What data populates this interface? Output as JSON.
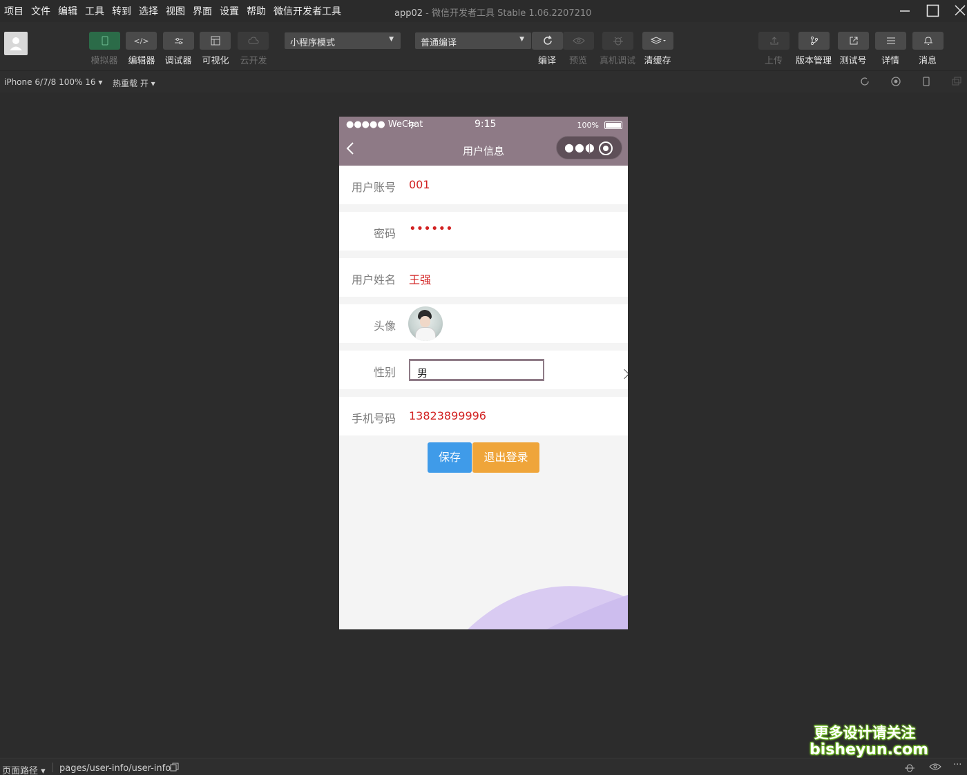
{
  "menu": [
    "项目",
    "文件",
    "编辑",
    "工具",
    "转到",
    "选择",
    "视图",
    "界面",
    "设置",
    "帮助",
    "微信开发者工具"
  ],
  "window": {
    "project": "app02",
    "separator": " - ",
    "app": "微信开发者工具 Stable 1.06.2207210"
  },
  "toolbar": {
    "left_buttons": [
      {
        "label": "模拟器",
        "icon": "phone-icon"
      },
      {
        "label": "编辑器",
        "icon": "code-icon"
      },
      {
        "label": "调试器",
        "icon": "sliders-icon"
      },
      {
        "label": "可视化",
        "icon": "layout-icon"
      },
      {
        "label": "云开发",
        "icon": "cloud-icon"
      }
    ],
    "mode_select": "小程序模式",
    "compile_select": "普通编译",
    "mid_buttons": [
      {
        "label": "编译",
        "icon": "refresh-icon"
      },
      {
        "label": "预览",
        "icon": "eye-icon"
      },
      {
        "label": "真机调试",
        "icon": "bug-icon"
      },
      {
        "label": "清缓存",
        "icon": "layers-icon"
      }
    ],
    "right_buttons": [
      {
        "label": "上传",
        "icon": "upload-icon"
      },
      {
        "label": "版本管理",
        "icon": "branch-icon"
      },
      {
        "label": "测试号",
        "icon": "external-link-icon"
      },
      {
        "label": "详情",
        "icon": "menu-icon"
      },
      {
        "label": "消息",
        "icon": "bell-icon"
      }
    ]
  },
  "subbar": {
    "device": "iPhone 6/7/8 100% 16 ▾",
    "hot_reload": "热重载 开 ▾"
  },
  "phone": {
    "status": {
      "signal": "●●●●● WeChat",
      "time": "9:15",
      "battery": "100%"
    },
    "nav_title": "用户信息",
    "fields": [
      {
        "label": "用户账号",
        "value": "001"
      },
      {
        "label": "密码",
        "value": "••••••"
      },
      {
        "label": "用户姓名",
        "value": "王强"
      },
      {
        "label": "头像",
        "value": ""
      },
      {
        "label": "性别",
        "value": "男"
      },
      {
        "label": "手机号码",
        "value": "13823899996"
      }
    ],
    "save_label": "保存",
    "logout_label": "退出登录"
  },
  "footer": {
    "path_label": "页面路径 ▾",
    "path": "pages/user-info/user-info"
  },
  "watermark": {
    "line1": "更多设计请关注",
    "line2": "bisheyun.com"
  },
  "colors": {
    "nav": "#8e7a86",
    "value_red": "#d22222",
    "save": "#3f9be9",
    "logout": "#efa53a"
  }
}
